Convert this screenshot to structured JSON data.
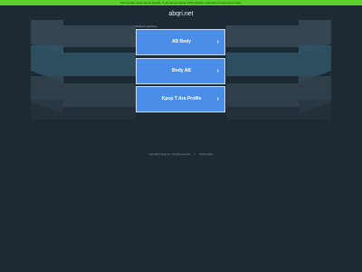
{
  "banner": {
    "text": "This domain name can be bought. If you are the owner of this domain, click here to lease the domain."
  },
  "header": {
    "domain": "abqri.net"
  },
  "related": {
    "label": "Related searches",
    "links": [
      {
        "label": "AB Body"
      },
      {
        "label": "Body AB"
      },
      {
        "label": "Kpop T Ara Profile"
      }
    ]
  },
  "footer": {
    "copyright": "Copyright © abqri.net · All rights reserved",
    "privacy": "Privacy Policy"
  },
  "colors": {
    "background": "#1e2a33",
    "banner": "#59d12a",
    "link_button": "#4a8eea"
  }
}
